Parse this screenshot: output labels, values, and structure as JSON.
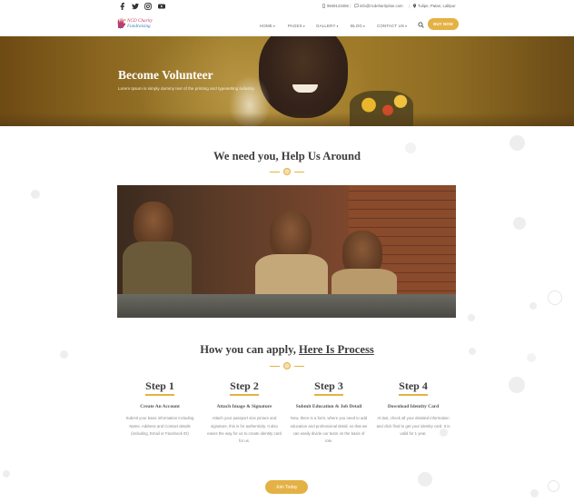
{
  "topbar": {
    "social": [
      "facebook-icon",
      "twitter-icon",
      "instagram-icon",
      "youtube-icon"
    ],
    "phone": "9849123456",
    "email": "info@ncdeharityrlan.com",
    "location": "Tulipe, Patan, Lalitpur"
  },
  "header": {
    "logo_line1": "NCD Charity",
    "logo_line2": "Fundraising",
    "nav": [
      "HOME",
      "PAGES",
      "GALLERY",
      "BLOG",
      "CONTACT US"
    ],
    "donate_label": "BUY NOW"
  },
  "hero": {
    "title": "Become Volunteer",
    "subtitle": "Lorem Ipsum is simply dummy text of the printing and typesetting industry."
  },
  "section1": {
    "title": "We need you, Help Us Around"
  },
  "section2": {
    "title_plain": "How you can apply, ",
    "title_link": "Here Is Process",
    "steps": [
      {
        "label": "Step 1",
        "name": "Create An Account",
        "desc": "Submit your basic information including Name, Address and Contact details (including, Email or Facebook ID)"
      },
      {
        "label": "Step 2",
        "name": "Attach Image & Signature",
        "desc": "Attach your passport size picture and signature, this is for authenticity. It also eases the way for us to create identity card for us."
      },
      {
        "label": "Step 3",
        "name": "Submit Education & Job Detail",
        "desc": "Now, there is a form, where you need to add education and professional detail, so that we can easily divide our team on the basis of role."
      },
      {
        "label": "Step 4",
        "name": "Download Identity Card",
        "desc": "At last, check all your detailed information and click final to get your identity card. It is valid for 1 year."
      }
    ],
    "join_label": "Join Today"
  },
  "colors": {
    "accent": "#e4b144",
    "heading": "#3d3d3d",
    "text": "#8a8a8a"
  }
}
